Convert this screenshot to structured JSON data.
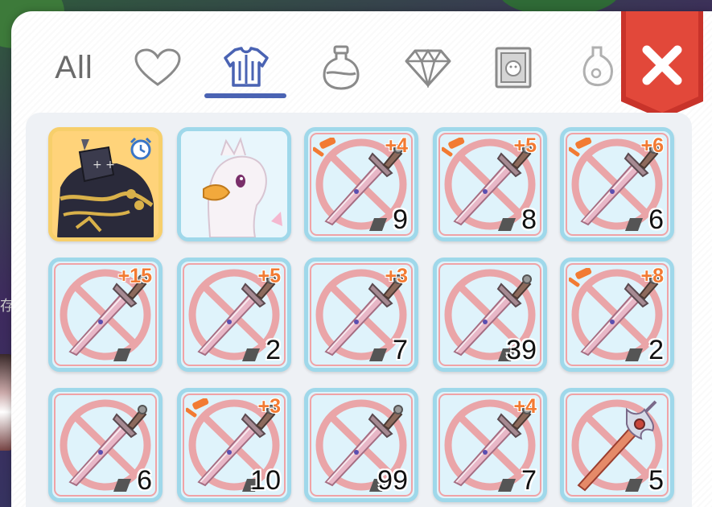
{
  "tabs": [
    {
      "name": "tab-all",
      "label": "All",
      "icon": null,
      "active": false
    },
    {
      "name": "tab-favorites",
      "label": "",
      "icon": "heart-icon",
      "active": false
    },
    {
      "name": "tab-equipment",
      "label": "",
      "icon": "armor-icon",
      "active": true
    },
    {
      "name": "tab-consumables",
      "label": "",
      "icon": "potion-icon",
      "active": false
    },
    {
      "name": "tab-gems",
      "label": "",
      "icon": "diamond-icon",
      "active": false
    },
    {
      "name": "tab-cards",
      "label": "",
      "icon": "card-icon",
      "active": false
    },
    {
      "name": "tab-misc",
      "label": "",
      "icon": "bottle-icon",
      "active": false
    }
  ],
  "close_button": {
    "icon": "close-icon",
    "color": "#d23a2b"
  },
  "side_text": "存",
  "colors": {
    "accent": "#4a63b3",
    "refine": "#f27b33",
    "slot_border": "#9fd8ea",
    "gold_slot": "#f7cf6b"
  },
  "items": [
    {
      "type": "knight-costume",
      "refine": "",
      "qty": "",
      "hammer": false,
      "timer": true
    },
    {
      "type": "bird-pet",
      "refine": "",
      "qty": "",
      "hammer": false,
      "timer": false
    },
    {
      "type": "dagger",
      "refine": "+4",
      "qty": "9",
      "hammer": true,
      "timer": false
    },
    {
      "type": "dagger",
      "refine": "+5",
      "qty": "8",
      "hammer": true,
      "timer": false
    },
    {
      "type": "dagger",
      "refine": "+6",
      "qty": "6",
      "hammer": true,
      "timer": false
    },
    {
      "type": "dagger",
      "refine": "+15",
      "qty": "",
      "hammer": false,
      "timer": false
    },
    {
      "type": "dagger",
      "refine": "+5",
      "qty": "2",
      "hammer": false,
      "timer": false
    },
    {
      "type": "dagger",
      "refine": "+3",
      "qty": "7",
      "hammer": false,
      "timer": false
    },
    {
      "type": "dagger",
      "refine": "",
      "qty": "39",
      "hammer": false,
      "timer": false
    },
    {
      "type": "dagger",
      "refine": "+8",
      "qty": "2",
      "hammer": true,
      "timer": false
    },
    {
      "type": "dagger",
      "refine": "",
      "qty": "6",
      "hammer": false,
      "timer": false
    },
    {
      "type": "dagger",
      "refine": "+3",
      "qty": "10",
      "hammer": true,
      "timer": false
    },
    {
      "type": "dagger",
      "refine": "",
      "qty": "99",
      "hammer": false,
      "timer": false
    },
    {
      "type": "dagger",
      "refine": "+4",
      "qty": "7",
      "hammer": false,
      "timer": false
    },
    {
      "type": "ornate-sword",
      "refine": "",
      "qty": "5",
      "hammer": false,
      "timer": false
    }
  ]
}
